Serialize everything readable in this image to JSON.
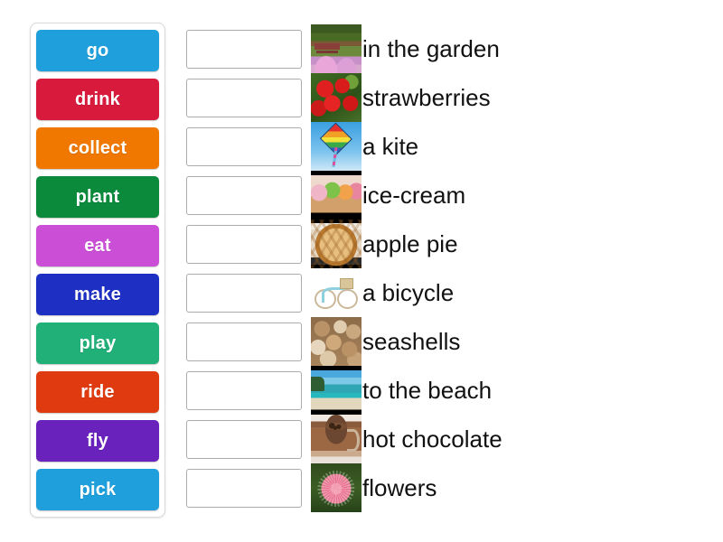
{
  "word_bank": {
    "label": "word-bank",
    "chips": [
      {
        "label": "go",
        "color": "#1fa0dc"
      },
      {
        "label": "drink",
        "color": "#d81b3c"
      },
      {
        "label": "collect",
        "color": "#f07800"
      },
      {
        "label": "plant",
        "color": "#0b8a3c"
      },
      {
        "label": "eat",
        "color": "#cb4fd6"
      },
      {
        "label": "make",
        "color": "#1e2fc4"
      },
      {
        "label": "play",
        "color": "#22b079"
      },
      {
        "label": "ride",
        "color": "#e03a10"
      },
      {
        "label": "fly",
        "color": "#6a22bd"
      },
      {
        "label": "pick",
        "color": "#1fa0dc"
      }
    ]
  },
  "rows": [
    {
      "answer": "",
      "image": "garden-image",
      "label": "in the garden"
    },
    {
      "answer": "",
      "image": "strawberries-image",
      "label": "strawberries"
    },
    {
      "answer": "",
      "image": "kite-image",
      "label": "a kite"
    },
    {
      "answer": "",
      "image": "ice-cream-image",
      "label": "ice-cream"
    },
    {
      "answer": "",
      "image": "apple-pie-image",
      "label": "apple pie"
    },
    {
      "answer": "",
      "image": "bicycle-image",
      "label": "a bicycle"
    },
    {
      "answer": "",
      "image": "seashells-image",
      "label": "seashells"
    },
    {
      "answer": "",
      "image": "beach-image",
      "label": "to the beach"
    },
    {
      "answer": "",
      "image": "hot-chocolate-image",
      "label": "hot chocolate"
    },
    {
      "answer": "",
      "image": "flowers-image",
      "label": "flowers"
    }
  ]
}
